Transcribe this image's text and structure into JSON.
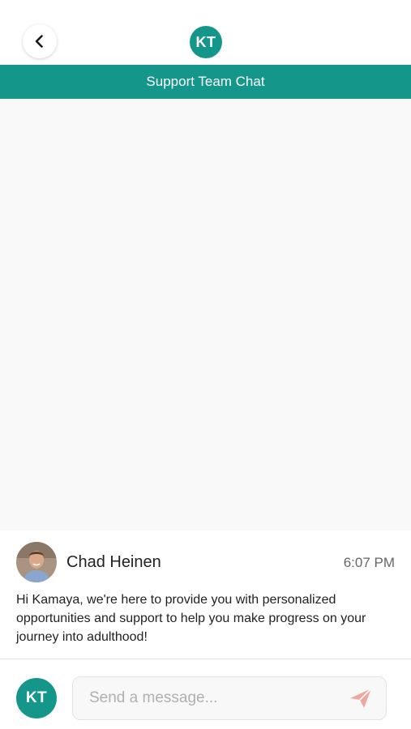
{
  "header": {
    "avatar_initials": "KT",
    "title": "Support Team Chat"
  },
  "message": {
    "sender": "Chad Heinen",
    "time": "6:07 PM",
    "text": "Hi Kamaya, we're here to provide you with personalized opportunities and support to help you make progress on your journey into adulthood!"
  },
  "composer": {
    "avatar_initials": "KT",
    "placeholder": "Send a message...",
    "value": ""
  },
  "icons": {
    "back": "chevron-left-icon",
    "send": "paper-plane-icon"
  },
  "colors": {
    "brand": "#14968a",
    "send_icon": "#f0a79d",
    "chat_background": "#f9f9f9"
  }
}
